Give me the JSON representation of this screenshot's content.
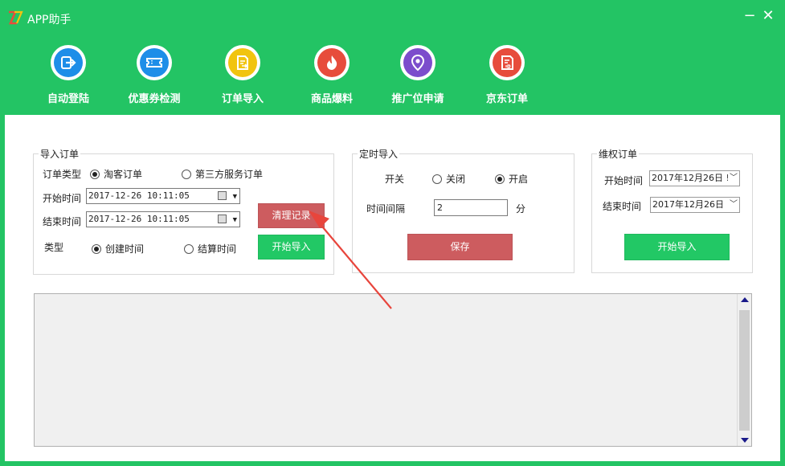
{
  "app": {
    "title": "APP助手",
    "minimize": "−",
    "close": "✕"
  },
  "toolbar": [
    {
      "label": "自动登陆",
      "icon": "login-arrow-icon",
      "color": "#1e8ee8"
    },
    {
      "label": "优惠券检测",
      "icon": "coupon-icon",
      "color": "#1e8ee8"
    },
    {
      "label": "订单导入",
      "icon": "order-import-icon",
      "color": "#f1c40f"
    },
    {
      "label": "商品爆料",
      "icon": "fire-icon",
      "color": "#e74c3c"
    },
    {
      "label": "推广位申请",
      "icon": "location-pin-icon",
      "color": "#7c4dcc"
    },
    {
      "label": "京东订单",
      "icon": "jd-order-icon",
      "color": "#e74c3c"
    }
  ],
  "import_orders": {
    "title": "导入订单",
    "order_type_label": "订单类型",
    "order_type_options": [
      "淘客订单",
      "第三方服务订单"
    ],
    "order_type_selected": "淘客订单",
    "start_label": "开始时间",
    "start_value": "2017-12-26 10:11:05",
    "end_label": "结束时间",
    "end_value": "2017-12-26 10:11:05",
    "kind_label": "类型",
    "kind_options": [
      "创建时间",
      "结算时间"
    ],
    "kind_selected": "创建时间",
    "clear_button": "清理记录",
    "start_import_button": "开始导入"
  },
  "timed_import": {
    "title": "定时导入",
    "switch_label": "开关",
    "switch_options": [
      "关闭",
      "开启"
    ],
    "switch_selected": "开启",
    "interval_label": "时间间隔",
    "interval_value": "2",
    "interval_unit": "分",
    "save_button": "保存"
  },
  "rights_orders": {
    "title": "维权订单",
    "start_label": "开始时间",
    "start_value": "2017年12月26日 !",
    "end_label": "结束时间",
    "end_value": "2017年12月26日 !",
    "start_import_button": "开始导入"
  },
  "colors": {
    "accent_green": "#23c464",
    "button_red": "#cd5c5f",
    "button_green": "#22c865",
    "annotation_arrow": "#e8453c"
  }
}
